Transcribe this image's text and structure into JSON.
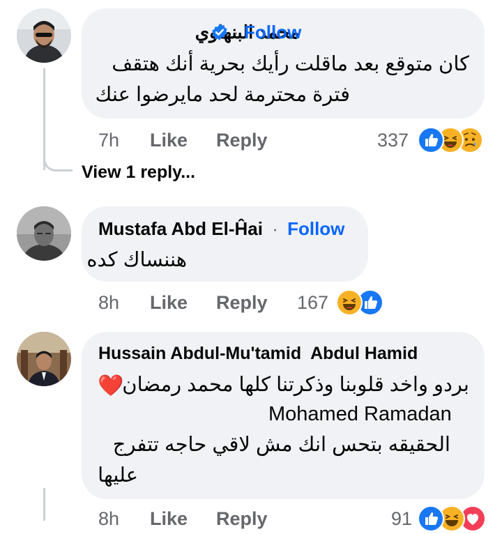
{
  "comments": [
    {
      "author": "محمد البنهاوي",
      "verified": true,
      "follow_label": "Follow",
      "lines": [
        "كان متوقع بعد ماقلت رأيك بحرية أنك هتقف",
        "فترة محترمة لحد مايرضوا عنك"
      ],
      "time": "7h",
      "like_label": "Like",
      "reply_label": "Reply",
      "reaction_count": "337",
      "reactions": [
        "like-icon",
        "haha-icon",
        "sad-icon"
      ],
      "view_replies": "View 1 reply..."
    },
    {
      "author": "Mustafa Abd El-Ĥai",
      "verified": false,
      "follow_label": "Follow",
      "lines": [
        "هننساك كده"
      ],
      "time": "8h",
      "like_label": "Like",
      "reply_label": "Reply",
      "reaction_count": "167",
      "reactions": [
        "haha-icon",
        "like-icon"
      ]
    },
    {
      "author": "Hussain Abdul-Mu'tamid  Abdul Hamid",
      "verified": false,
      "lines": [
        "بردو واخد قلوبنا وذكرتنا كلها محمد رمضان",
        "Mohamed Ramadan",
        "الحقيقه بتحس انك مش لاقي حاجه تتفرج",
        "عليها"
      ],
      "heart_emoji": "❤️",
      "time": "8h",
      "like_label": "Like",
      "reply_label": "Reply",
      "reaction_count": "91",
      "reactions": [
        "like-icon",
        "haha-icon",
        "love-icon"
      ]
    }
  ],
  "colors": {
    "bubble": "#f0f2f5",
    "follow": "#0866ff",
    "meta": "#65676b",
    "like": "#1877f2",
    "haha": "#f7b125",
    "love": "#f33e58"
  }
}
